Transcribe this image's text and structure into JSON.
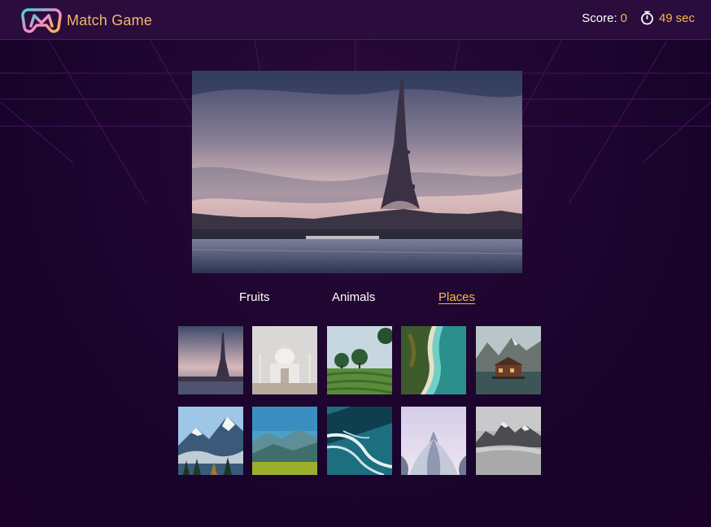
{
  "app": {
    "title": "Match Game"
  },
  "status": {
    "score_label": "Score:",
    "score_value": "0",
    "timer_value": "49",
    "timer_unit": "sec",
    "timer_icon": "stopwatch-icon"
  },
  "main_image": {
    "subject": "eiffel-tower-paris"
  },
  "tabs": [
    {
      "label": "Fruits",
      "active": false
    },
    {
      "label": "Animals",
      "active": false
    },
    {
      "label": "Places",
      "active": true
    }
  ],
  "tiles": [
    {
      "subject": "eiffel-tower"
    },
    {
      "subject": "taj-mahal"
    },
    {
      "subject": "tea-plantation"
    },
    {
      "subject": "aerial-beach"
    },
    {
      "subject": "lake-cabin"
    },
    {
      "subject": "snowy-mountains"
    },
    {
      "subject": "green-valley"
    },
    {
      "subject": "ocean-waves"
    },
    {
      "subject": "lotus-temple"
    },
    {
      "subject": "misty-peaks"
    }
  ],
  "colors": {
    "accent": "#f6b94c",
    "header_bg": "#2a0c3d",
    "page_bg": "#1f0631"
  }
}
